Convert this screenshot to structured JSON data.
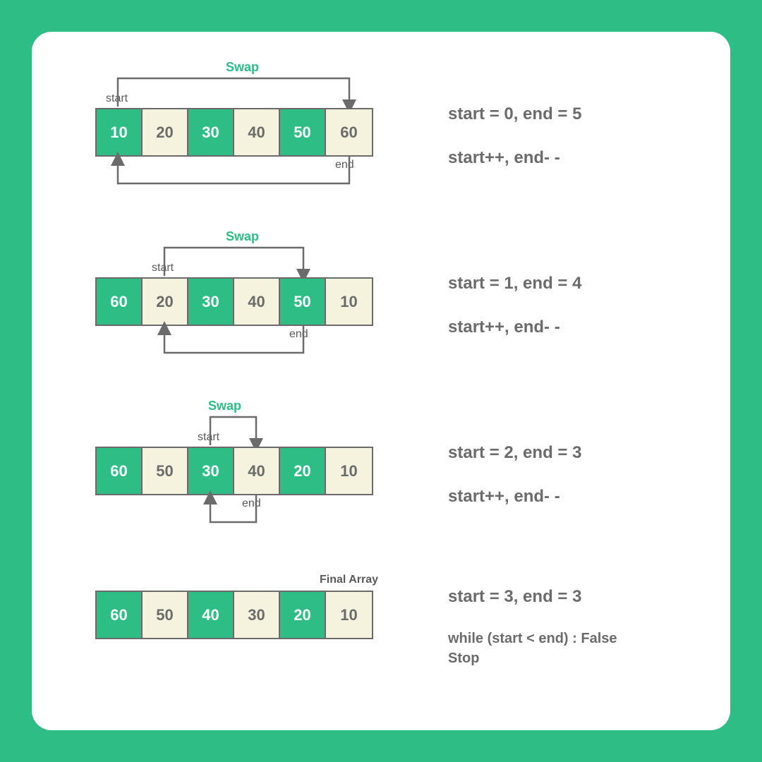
{
  "labels": {
    "swap": "Swap",
    "start": "start",
    "end": "end",
    "finalArray": "Final Array"
  },
  "steps": [
    {
      "cells": [
        "10",
        "20",
        "30",
        "40",
        "50",
        "60"
      ],
      "desc1": "start = 0, end = 5",
      "desc2": "start++, end- -",
      "startIdx": 0,
      "endIdx": 5
    },
    {
      "cells": [
        "60",
        "20",
        "30",
        "40",
        "50",
        "10"
      ],
      "desc1": "start = 1, end = 4",
      "desc2": "start++, end- -",
      "startIdx": 1,
      "endIdx": 4
    },
    {
      "cells": [
        "60",
        "50",
        "30",
        "40",
        "20",
        "10"
      ],
      "desc1": "start = 2, end = 3",
      "desc2": "start++, end- -",
      "startIdx": 2,
      "endIdx": 3
    },
    {
      "cells": [
        "60",
        "50",
        "40",
        "30",
        "20",
        "10"
      ],
      "desc1": "start = 3, end = 3",
      "desc2": "while (start < end) : False\nStop",
      "final": true
    }
  ]
}
